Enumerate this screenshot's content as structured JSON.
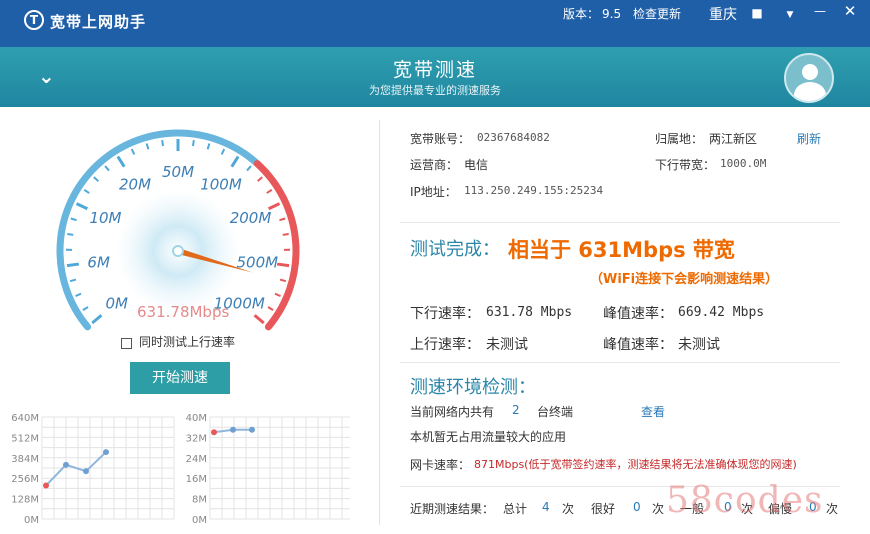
{
  "titlebar": {
    "app_title": "宽带上网助手",
    "version_label": "版本：",
    "version_value": "9.5",
    "check_update": "检查更新",
    "city": "重庆",
    "icons": [
      "skin-icon",
      "menu-dropdown-icon",
      "minimize-icon",
      "close-icon"
    ]
  },
  "header": {
    "title": "宽带测速",
    "subtitle": "为您提供最专业的测速服务"
  },
  "gauge": {
    "labels": [
      "0M",
      "6M",
      "10M",
      "20M",
      "50M",
      "100M",
      "200M",
      "500M",
      "1000M"
    ],
    "current_speed_text": "631.78Mbps",
    "current_speed": 631.78,
    "accent_blue": "#4ea8d8",
    "accent_red": "#e8585a"
  },
  "options": {
    "upload_test_label": "同时测试上行速率",
    "upload_test_checked": false,
    "start_button": "开始测速"
  },
  "mini_charts": {
    "download": {
      "y_labels": [
        "640M",
        "512M",
        "384M",
        "256M",
        "128M",
        "0M"
      ],
      "ylim": [
        0,
        640
      ],
      "values": [
        210,
        340,
        300,
        420
      ]
    },
    "upload": {
      "y_labels": [
        "40M",
        "32M",
        "24M",
        "16M",
        "8M",
        "0M"
      ],
      "ylim": [
        0,
        40
      ],
      "values": [
        34,
        35,
        35
      ]
    }
  },
  "account": {
    "account_label": "宽带账号：",
    "account_value": "02367684082",
    "location_label": "归属地：",
    "location_value": "两江新区",
    "refresh": "刷新",
    "isp_label": "运营商：",
    "isp_value": "电信",
    "bandwidth_label": "下行带宽：",
    "bandwidth_value": "1000.0M",
    "ip_label": "IP地址：",
    "ip_value": "113.250.249.155:25234"
  },
  "result": {
    "done_label": "测试完成：",
    "equivalent": "相当于 631Mbps 带宽",
    "wifi_note": "（WiFi连接下会影响测速结果）",
    "down_label": "下行速率：",
    "down_value": "631.78 Mbps",
    "peak_label": "峰值速率：",
    "peak_value": "669.42 Mbps",
    "up_label": "上行速率：",
    "up_value": "未测试",
    "up_peak_label": "峰值速率：",
    "up_peak_value": "未测试"
  },
  "env": {
    "title": "测速环境检测：",
    "devices_prefix": "当前网络内共有",
    "devices_count": "2",
    "devices_suffix": "台终端",
    "view": "查看",
    "no_heavy_apps": "本机暂无占用流量较大的应用",
    "nic_label": "网卡速率：",
    "nic_warning": "871Mbps(低于宽带签约速率，测速结果将无法准确体现您的网速)"
  },
  "recent": {
    "label": "近期测速结果：",
    "total_label": "总计",
    "total": "4",
    "unit": "次",
    "good_label": "很好",
    "good": "0",
    "normal_label": "一般",
    "normal": "0",
    "low_label": "偏慢",
    "low": "0"
  },
  "watermark": "58codes"
}
